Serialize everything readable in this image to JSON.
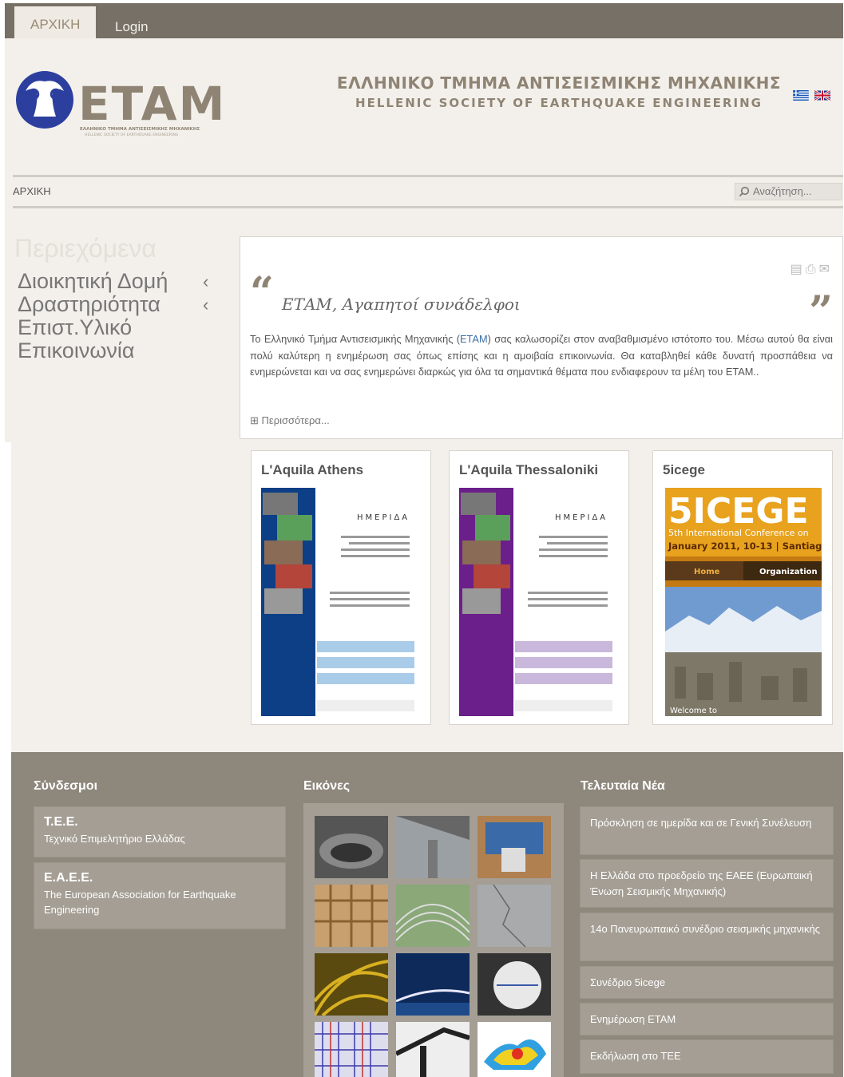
{
  "nav": {
    "tabs": [
      "ΑΡΧΙΚΗ",
      "Login"
    ]
  },
  "header": {
    "logo_text": "ETAM",
    "logo_sub_gr": "ΕΛΛΗΝΙΚΟ ΤΜΗΜΑ ΑΝΤΙΣΕΙΣΜΙΚΗΣ ΜΗΧΑΝΙΚΗΣ",
    "logo_sub_en": "HELLENIC SOCIETY OF EARTHQUAKE ENGINEERING",
    "title_gr": "ΕΛΛΗΝΙΚΟ ΤΜΗΜΑ ΑΝΤΙΣΕΙΣΜΙΚΗΣ ΜΗΧΑΝΙΚΗΣ",
    "title_en": "HELLENIC SOCIETY OF EARTHQUAKE ENGINEERING"
  },
  "breadcrumb": "ΑΡΧΙΚΗ",
  "search": {
    "placeholder": "Αναζήτηση..."
  },
  "menu": {
    "title": "Περιεχόμενα",
    "items": [
      {
        "label": "Διοικητική Δομή",
        "chevron": "‹"
      },
      {
        "label": "Δραστηριότητα",
        "chevron": "‹"
      },
      {
        "label": "Επιστ.Υλικό",
        "chevron": ""
      },
      {
        "label": "Επικοινωνία",
        "chevron": ""
      }
    ]
  },
  "article": {
    "title": "ΕΤΑΜ, Αγαπητοί συνάδελφοι",
    "body_1": "Το Ελληνικό Τμήμα Αντισεισμικής Μηχανικής (",
    "body_link": "ΕΤΑΜ",
    "body_2": ") σας καλωσορίζει στον αναβαθμισμένο ιστότοπο του. Μέσω αυτού θα είναι πολύ καλύτερη η ενημέρωση σας όπως επίσης και η αμοιβαία επικοινωνία. Θα καταβληθεί κάθε δυνατή προσπάθεια να ενημερώνεται και να σας ενημερώνει διαρκώς για όλα τα σημαντικά θέματα που ενδιαφερουν τα μέλη του ΕΤΑΜ..",
    "read_more": "Περισσότερα..."
  },
  "cards": [
    {
      "title": "L'Aquila Athens",
      "poster_heading": "ΗΜΕΡΙΔΑ",
      "color": "#0d3f86"
    },
    {
      "title": "L'Aquila Thessaloniki",
      "poster_heading": "ΗΜΕΡΙΔΑ",
      "color": "#6b1f8a"
    },
    {
      "title": "5icege",
      "banner_big": "5ICEGE",
      "banner_sub": "5th International Conference on",
      "banner_date": "January 2011, 10-13 | Santiag",
      "tab_home": "Home",
      "tab_org": "Organization",
      "welcome": "Welcome to"
    }
  ],
  "footer": {
    "links_title": "Σύνδεσμοι",
    "links": [
      {
        "title": "T.E.E.",
        "desc": "Τεχνικό Επιμελητήριο Ελλάδας"
      },
      {
        "title": "E.A.E.E.",
        "desc": "The European Association for Earthquake Engineering"
      }
    ],
    "images_title": "Εικόνες",
    "news_title": "Τελευταία Νέα",
    "news": [
      "Πρόσκληση σε ημερίδα και σε Γενική Συνέλευση",
      "Η Ελλάδα στο προεδρείο της ΕΑΕΕ (Ευρωπαική Ένωση Σεισμικής Μηχανικής)",
      "14ο Πανευρωπαικό συνέδριο σεισμικής μηχανικής",
      "Συνέδριο 5icege",
      "Ενημέρωση ΕΤΑΜ",
      "Εκδήλωση στο ΤΕΕ"
    ]
  },
  "colors": {
    "topbar": "#767066",
    "cream": "#f3f0eb",
    "footer": "#8e877c",
    "accent": "#8f8474",
    "link": "#3a6ea5"
  }
}
